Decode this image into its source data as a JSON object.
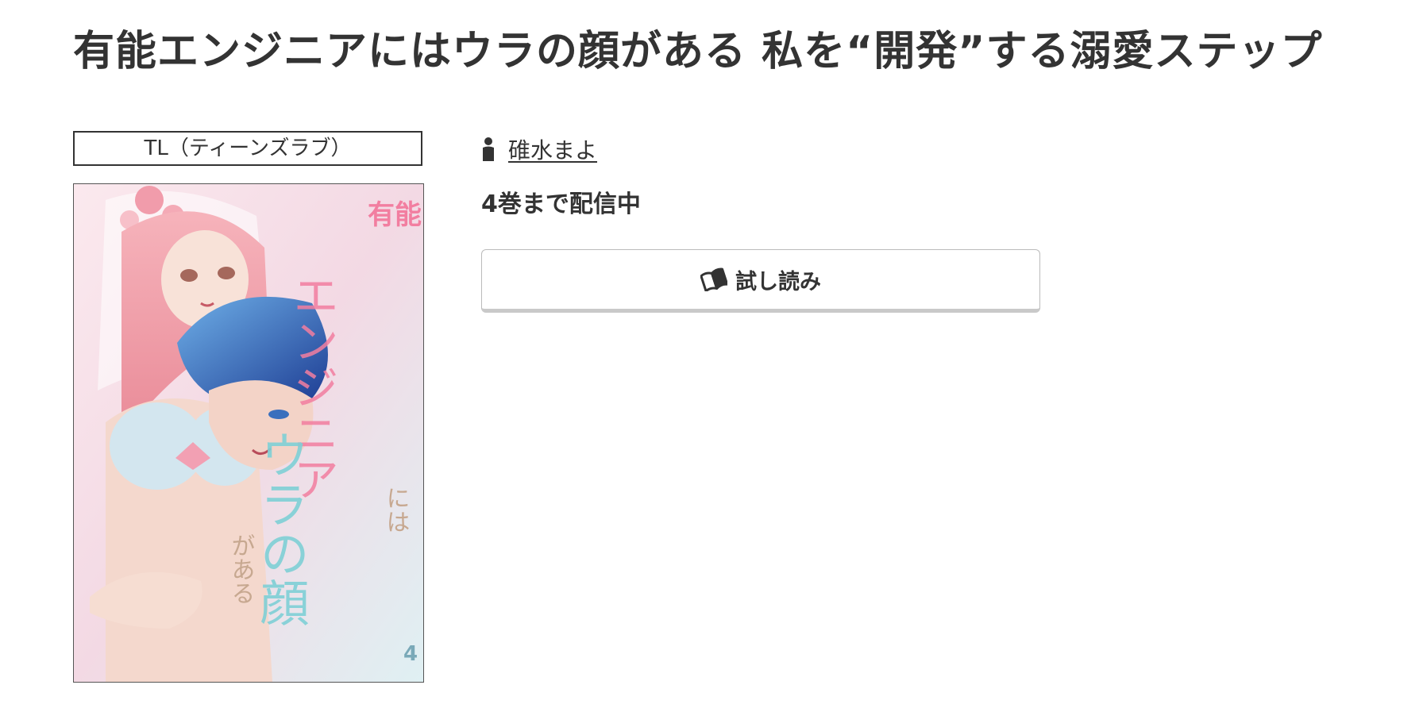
{
  "page": {
    "title": "有能エンジニアにはウラの顔がある 私を“開発”する溺愛ステップ",
    "genre": "TL（ティーンズラブ）",
    "author": {
      "name": "碓水まよ",
      "icon": "person-icon"
    },
    "volumes_status": "4巻まで配信中",
    "trial_button": {
      "label": "試し読み",
      "icon": "open-book-icon"
    }
  },
  "cover": {
    "title_lines": [
      "有能",
      "エンジニア",
      "には",
      "ウラの顔",
      "がある"
    ],
    "volume_number": "4",
    "palette": {
      "background": "#f6dfe6",
      "hair_pink": "#ee9aa5",
      "hair_blue": "#2f5fb8",
      "skin": "#f7ddd2",
      "lingerie": "#cfe3ee",
      "title_pink": "#f27ea0",
      "title_teal": "#7fd0d6"
    }
  }
}
